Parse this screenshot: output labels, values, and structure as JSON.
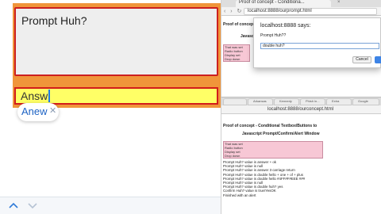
{
  "app": {
    "prompt_title": "Prompt Huh?",
    "answer_value": "Answ",
    "suggestion": "Anew",
    "suggestion_close": "✕"
  },
  "browser_top": {
    "tab_title": "Proof of concept - Conditiona...",
    "tab_close": "×",
    "url": "localhost:8888/ourprompt.html",
    "page_heading": "Proof of concept - Conditional Textbox/Buttons to",
    "page_sub": "Javascript Prompt/Confirm/Alert Window",
    "pink_lines": [
      "That was set",
      "Radio button",
      "Display set",
      "Drop down"
    ]
  },
  "dialog": {
    "title": "localhost:8888 says:",
    "message": "Prompt Huh??",
    "input_value": "double huh?",
    "cancel_label": "Cancel"
  },
  "browser_bot": {
    "tabs": [
      "",
      "Arkansas",
      "Kennedy",
      "Phish in...",
      "Extra",
      "Google"
    ],
    "url": "localhost:8888/ourconcept.html",
    "page_heading": "Proof of concept - Conditional Textbox/Buttons to",
    "page_sub": "Javascript Prompt/Confirm/Alert Window",
    "pink_lines": [
      "That was set",
      "Radio button",
      "Display set",
      "Drop down"
    ],
    "log_lines": [
      "Prompt Huh? value is answer + ok",
      "Prompt Huh? value is null",
      "Prompt Huh? value is answer 3 carriage return",
      "Prompt Huh? value is double hello + one + of + plus",
      "Prompt Huh? value is double hello #4FF#F#EEE ###",
      "Prompt Huh? value is null",
      "Prompt Huh? value is double huh? yes",
      "Confirm Huh? value is true/YesOK",
      "Finished with an alert"
    ]
  },
  "colors": {
    "orange": "#f0953a",
    "answer_bg": "#ffff66",
    "accent_red": "#cc1f1f",
    "pink": "#f7c7d5",
    "link_blue": "#1e63c4"
  }
}
